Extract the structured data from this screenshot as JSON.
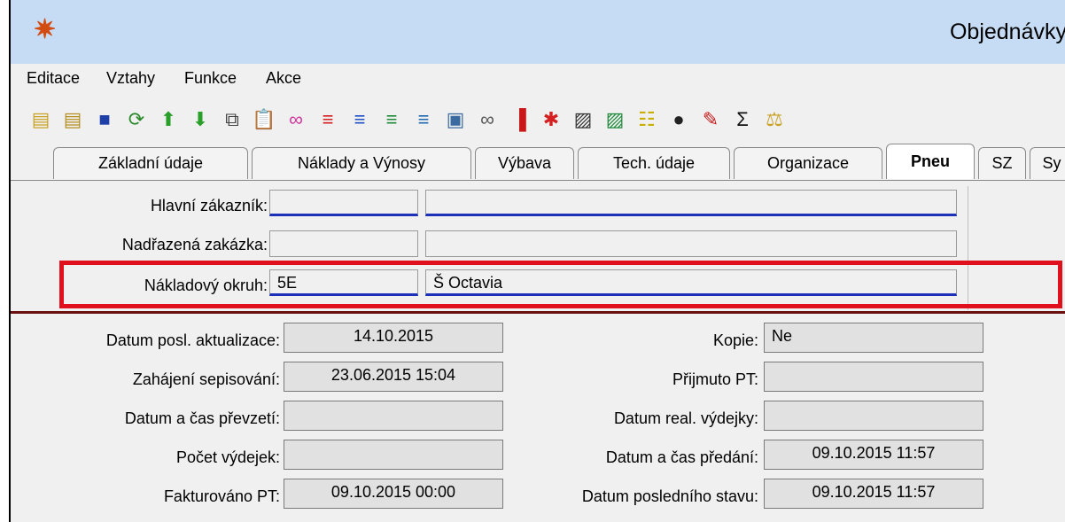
{
  "window": {
    "title": "Objednávky"
  },
  "menu": [
    "Editace",
    "Vztahy",
    "Funkce",
    "Akce"
  ],
  "toolbar": [
    {
      "icon": "new-record-icon",
      "glyph": "▤",
      "color": "#c9a227"
    },
    {
      "icon": "copy-record-icon",
      "glyph": "▤",
      "color": "#b58f22"
    },
    {
      "icon": "save-icon",
      "glyph": "■",
      "color": "#1f3fa8"
    },
    {
      "icon": "refresh-icon",
      "glyph": "⟳",
      "color": "#2a8a2a"
    },
    {
      "icon": "arrow-up-icon",
      "glyph": "⬆",
      "color": "#2aa02a"
    },
    {
      "icon": "arrow-down-icon",
      "glyph": "⬇",
      "color": "#2aa02a"
    },
    {
      "icon": "copy-icon",
      "glyph": "⧉",
      "color": "#444"
    },
    {
      "icon": "paste-icon",
      "glyph": "📋",
      "color": "#b58f22"
    },
    {
      "icon": "glasses-icon",
      "glyph": "∞",
      "color": "#d0339a"
    },
    {
      "icon": "filter-red-icon",
      "glyph": "≡",
      "color": "#d42020"
    },
    {
      "icon": "filter-blue-icon",
      "glyph": "≡",
      "color": "#2050c8"
    },
    {
      "icon": "filter-green-icon",
      "glyph": "≡",
      "color": "#1f8a3a"
    },
    {
      "icon": "filter-mixed-icon",
      "glyph": "≡",
      "color": "#1f6ab0"
    },
    {
      "icon": "printer-icon",
      "glyph": "▣",
      "color": "#3a6aa0"
    },
    {
      "icon": "link-icon",
      "glyph": "∞",
      "color": "#555"
    },
    {
      "icon": "traffic-light-icon",
      "glyph": "▐",
      "color": "#c81818"
    },
    {
      "icon": "person-icon",
      "glyph": "✱",
      "color": "#d42020"
    },
    {
      "icon": "document-icon",
      "glyph": "▨",
      "color": "#333"
    },
    {
      "icon": "document-arrow-icon",
      "glyph": "▨",
      "color": "#1f8a3a"
    },
    {
      "icon": "list-icon",
      "glyph": "☷",
      "color": "#c9b000"
    },
    {
      "icon": "bomb-icon",
      "glyph": "●",
      "color": "#222"
    },
    {
      "icon": "edit-form-icon",
      "glyph": "✎",
      "color": "#c81818"
    },
    {
      "icon": "sum-icon",
      "glyph": "Σ",
      "color": "#111"
    },
    {
      "icon": "balance-icon",
      "glyph": "⚖",
      "color": "#c9a227"
    }
  ],
  "tabs": [
    {
      "label": "Základní údaje",
      "active": false
    },
    {
      "label": "Náklady a Výnosy",
      "active": false
    },
    {
      "label": "Výbava",
      "active": false
    },
    {
      "label": "Tech. údaje",
      "active": false
    },
    {
      "label": "Organizace",
      "active": false
    },
    {
      "label": "Pneu",
      "active": true
    },
    {
      "label": "SZ",
      "active": false
    },
    {
      "label": "Sy",
      "active": false
    }
  ],
  "form": {
    "hlavni_zakaznik_label": "Hlavní zákazník:",
    "hlavni_zakaznik_code": "",
    "hlavni_zakaznik_name": "",
    "nadrazena_zakazka_label": "Nadřazená zakázka:",
    "nadrazena_zakazka_code": "",
    "nadrazena_zakazka_name": "",
    "nakladovy_okruh_label": "Nákladový okruh:",
    "nakladovy_okruh_code": "5E",
    "nakladovy_okruh_name": "Š Octavia"
  },
  "details": {
    "datum_posl_aktualizace_label": "Datum posl. aktualizace:",
    "datum_posl_aktualizace": "14.10.2015",
    "zahajeni_sepisovani_label": "Zahájení sepisování:",
    "zahajeni_sepisovani": "23.06.2015 15:04",
    "datum_cas_prevzeti_label": "Datum a čas převzetí:",
    "datum_cas_prevzeti": "",
    "pocet_vydejek_label": "Počet výdejek:",
    "pocet_vydejek": "",
    "fakturovano_pt_label": "Fakturováno PT:",
    "fakturovano_pt": "09.10.2015 00:00",
    "kopie_label": "Kopie:",
    "kopie": "Ne",
    "prijmuto_pt_label": "Přijmuto PT:",
    "prijmuto_pt": "",
    "datum_real_vydejky_label": "Datum real. výdejky:",
    "datum_real_vydejky": "",
    "datum_cas_predani_label": "Datum a čas předání:",
    "datum_cas_predani": "09.10.2015 11:57",
    "datum_posledniho_stavu_label": "Datum posledního stavu:",
    "datum_posledniho_stavu": "09.10.2015 11:57"
  },
  "highlight_color": "#e0101c"
}
